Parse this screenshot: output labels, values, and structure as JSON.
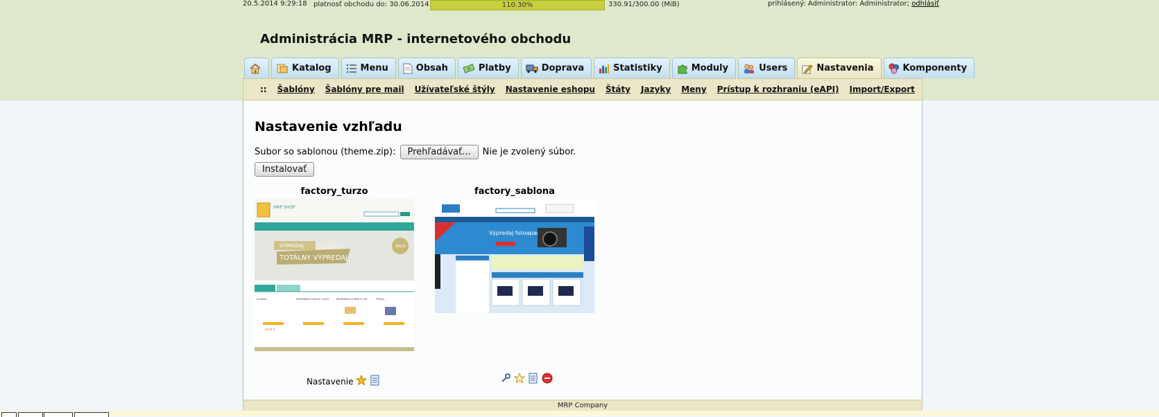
{
  "status": {
    "datetime": "20.5.2014 9:29:18",
    "validity": "platnosť obchodu do: 30.06.2014",
    "usage_percent": "110.30%",
    "storage": "330.91/300.00 (MiB)",
    "login_text": "prihlásený: Administrator: Administrator;",
    "logout_label": "odhlásiť"
  },
  "header": {
    "title": "Administrácia MRP - internetového obchodu"
  },
  "tabs": [
    {
      "label": "",
      "icon": "home-icon"
    },
    {
      "label": "Katalog",
      "icon": "catalog-icon"
    },
    {
      "label": "Menu",
      "icon": "list-icon"
    },
    {
      "label": "Obsah",
      "icon": "document-icon"
    },
    {
      "label": "Platby",
      "icon": "money-icon"
    },
    {
      "label": "Doprava",
      "icon": "truck-icon"
    },
    {
      "label": "Statistiky",
      "icon": "bar-chart-icon"
    },
    {
      "label": "Moduly",
      "icon": "puzzle-icon"
    },
    {
      "label": "Users",
      "icon": "users-icon"
    },
    {
      "label": "Nastavenia",
      "icon": "settings-edit-icon",
      "active": true
    },
    {
      "label": "Komponenty",
      "icon": "components-icon"
    }
  ],
  "subnav": {
    "separator": "::",
    "items": [
      "Šablóny",
      "Šablóny pre mail",
      "Užívateľské štýly",
      "Nastavenie eshopu",
      "Štáty",
      "Jazyky",
      "Meny",
      "Prístup k rozhraniu (eAPI)",
      "Import/Export"
    ]
  },
  "main": {
    "heading": "Nastavenie vzhľadu",
    "upload_label": "Subor so sablonou (theme.zip):",
    "browse_button": "Prehľadávať...",
    "no_file": "Nie je zvolený súbor.",
    "install_button": "Instalovať"
  },
  "themes": [
    {
      "name": "factory_turzo",
      "settings_label": "Nastavenie",
      "shop_title": "MRP SHOP",
      "banner_small": "VÝPREDAJ",
      "banner_big": "TOTÁLNY VÝPREDAJ",
      "badge": "AKCIA",
      "products": [
        "ŠĽAHAČ...",
        "MOZZARELLA BLOK 1,6 KG",
        "MOZZARELLA MINI 10 KG",
        "PIZZA..."
      ],
      "price_sample": "34,00 €"
    },
    {
      "name": "factory_sablona",
      "banner_text": "Výpredaj fotoaparátov"
    }
  ],
  "footer": {
    "text": "MRP Company"
  },
  "colors": {
    "header_bg": "#dfe8cb",
    "accent_green": "#c8cf3e",
    "tab_blue": "#c2dff0",
    "subnav_bg": "#ebe6c7"
  }
}
